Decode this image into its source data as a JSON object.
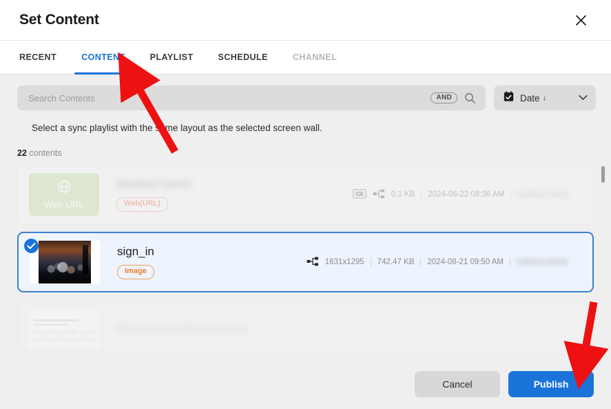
{
  "dialog": {
    "title": "Set Content",
    "close_icon": "close-icon"
  },
  "tabs": [
    {
      "label": "RECENT",
      "state": "normal"
    },
    {
      "label": "CONTENT",
      "state": "active"
    },
    {
      "label": "PLAYLIST",
      "state": "normal"
    },
    {
      "label": "SCHEDULE",
      "state": "normal"
    },
    {
      "label": "CHANNEL",
      "state": "disabled"
    }
  ],
  "search": {
    "placeholder": "Search Contents",
    "value": "",
    "operator_badge": "AND",
    "search_icon": "search-icon"
  },
  "sort": {
    "calendar_icon": "calendar-check-icon",
    "label": "Date",
    "direction_arrow": "↓",
    "chevron_icon": "chevron-down-icon"
  },
  "hint": "Select a sync playlist with the same layout as the selected screen wall.",
  "count": {
    "number": "22",
    "label": "contents"
  },
  "list": [
    {
      "name": "",
      "name_masked": true,
      "type_pill": "Web(URL)",
      "thumb_kind": "web-url",
      "thumb_label": "Web URL",
      "resolution": "",
      "size": "0.1 KB",
      "date": "2024-08-22 08:36 AM",
      "owner_masked": true,
      "media_icon": "media-play-icon",
      "network_icon": "network-share-icon",
      "selected": false,
      "faded": true
    },
    {
      "name": "sign_in",
      "name_masked": false,
      "type_pill": "Image",
      "thumb_kind": "photo",
      "thumb_label": "",
      "resolution": "1631x1295",
      "size": "742.47 KB",
      "date": "2024-08-21 09:50 AM",
      "owner_masked": true,
      "media_icon": "",
      "network_icon": "network-share-icon",
      "selected": true,
      "faded": false
    },
    {
      "name": "",
      "name_masked": true,
      "type_pill": "",
      "thumb_kind": "document",
      "thumb_label": "",
      "resolution": "",
      "size": "",
      "date": "",
      "owner_masked": true,
      "media_icon": "",
      "network_icon": "",
      "selected": false,
      "faded": true
    }
  ],
  "scrollbar": {
    "name": "list-scrollbar"
  },
  "footer": {
    "cancel_label": "Cancel",
    "publish_label": "Publish"
  },
  "colors": {
    "accent": "#1a73d9",
    "selected_row_bg": "#eef4fd",
    "pill_web": "#f0836a",
    "pill_image": "#ef7e2e",
    "annotation_arrow": "#ee1111",
    "web_thumb_bg": "#c9dfb0"
  }
}
